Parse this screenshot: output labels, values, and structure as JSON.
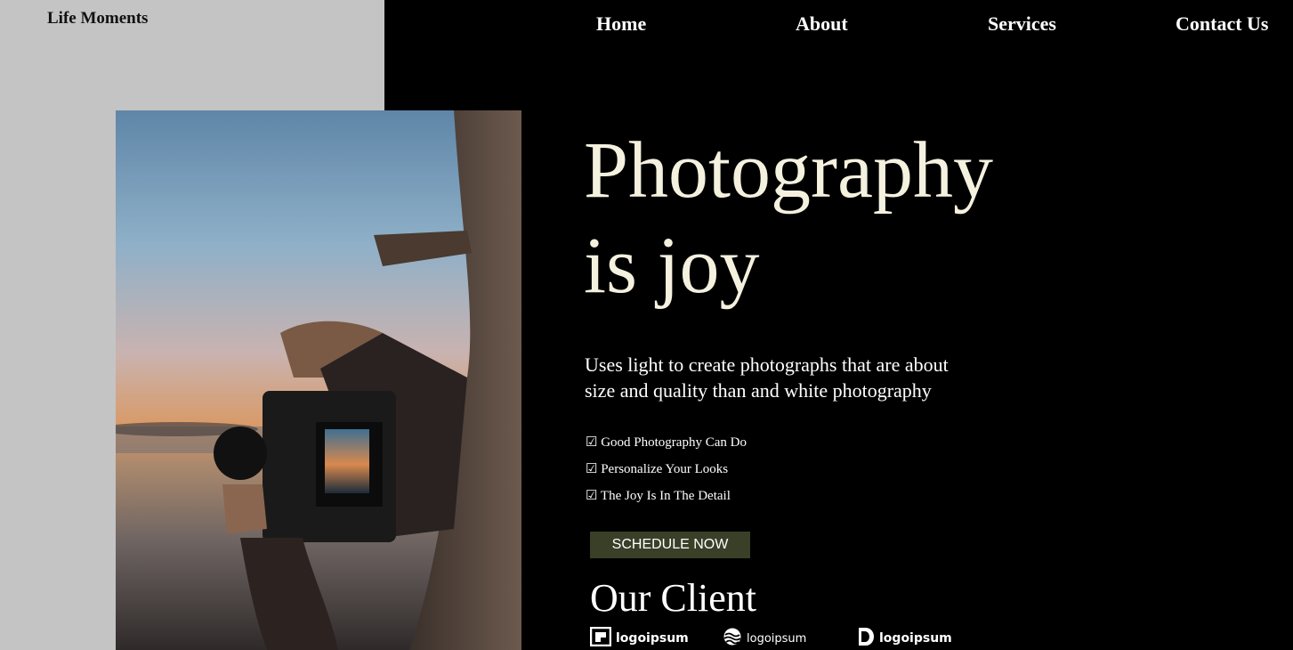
{
  "brand": {
    "name": "Life Moments"
  },
  "nav": {
    "items": [
      {
        "label": "Home"
      },
      {
        "label": "About"
      },
      {
        "label": "Services"
      },
      {
        "label": "Contact Us"
      }
    ]
  },
  "hero": {
    "headline_line1": "Photography",
    "headline_line2": "is joy",
    "subtext": "Uses light to create photographs that are about size and quality than and white photography",
    "features": [
      "☑ Good Photography Can Do",
      "☑ Personalize Your Looks",
      "☑ The Joy Is In The Detail"
    ],
    "cta_label": "SCHEDULE NOW"
  },
  "clients": {
    "title": "Our Client",
    "logos": [
      {
        "text": "logoipsum",
        "icon": "square-c-logo-icon"
      },
      {
        "text": "logoipsum",
        "icon": "waves-logo-icon"
      },
      {
        "text": "logoipsum",
        "icon": "half-circle-logo-icon"
      }
    ]
  },
  "colors": {
    "page_background": "#000000",
    "left_panel": "#c4c4c4",
    "headline": "#f5f1df",
    "button": "#3a3f28"
  }
}
